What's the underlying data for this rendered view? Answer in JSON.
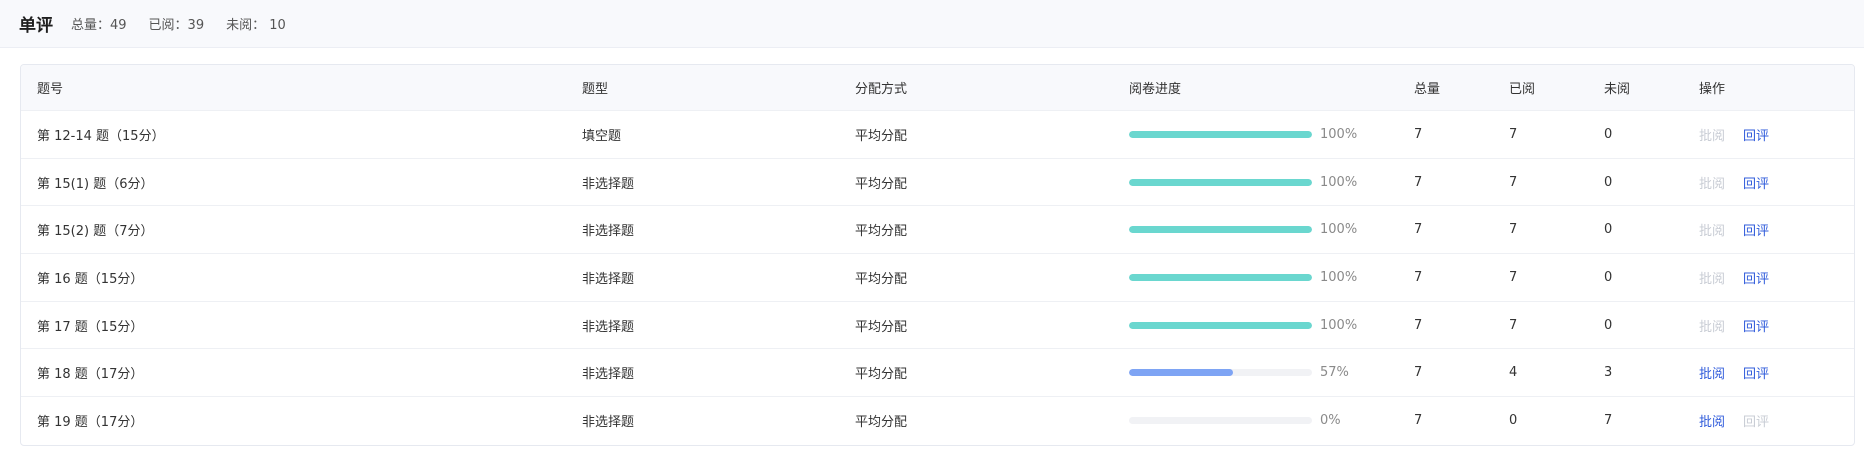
{
  "header": {
    "title": "单评",
    "total": "总量：49",
    "read": "已阅：39",
    "unread": "未阅： 10"
  },
  "table": {
    "columns": [
      "题号",
      "题型",
      "分配方式",
      "阅卷进度",
      "总量",
      "已阅",
      "未阅",
      "操作"
    ],
    "rows": [
      {
        "question": "第  12-14  题（15分）",
        "type": "填空题",
        "dist": "平均分配",
        "progress": 100,
        "progress_label": "100%",
        "total": "7",
        "read": "7",
        "unread": "0",
        "grade": "批阅",
        "grade_enabled": false,
        "review": "回评",
        "review_enabled": true
      },
      {
        "question": "第  15(1)  题（6分）",
        "type": "非选择题",
        "dist": "平均分配",
        "progress": 100,
        "progress_label": "100%",
        "total": "7",
        "read": "7",
        "unread": "0",
        "grade": "批阅",
        "grade_enabled": false,
        "review": "回评",
        "review_enabled": true
      },
      {
        "question": "第  15(2)  题（7分）",
        "type": "非选择题",
        "dist": "平均分配",
        "progress": 100,
        "progress_label": "100%",
        "total": "7",
        "read": "7",
        "unread": "0",
        "grade": "批阅",
        "grade_enabled": false,
        "review": "回评",
        "review_enabled": true
      },
      {
        "question": "第  16  题（15分）",
        "type": "非选择题",
        "dist": "平均分配",
        "progress": 100,
        "progress_label": "100%",
        "total": "7",
        "read": "7",
        "unread": "0",
        "grade": "批阅",
        "grade_enabled": false,
        "review": "回评",
        "review_enabled": true
      },
      {
        "question": "第  17  题（15分）",
        "type": "非选择题",
        "dist": "平均分配",
        "progress": 100,
        "progress_label": "100%",
        "total": "7",
        "read": "7",
        "unread": "0",
        "grade": "批阅",
        "grade_enabled": false,
        "review": "回评",
        "review_enabled": true
      },
      {
        "question": "第  18  题（17分）",
        "type": "非选择题",
        "dist": "平均分配",
        "progress": 57,
        "progress_label": "57%",
        "total": "7",
        "read": "4",
        "unread": "3",
        "grade": "批阅",
        "grade_enabled": true,
        "review": "回评",
        "review_enabled": true
      },
      {
        "question": "第  19  题（17分）",
        "type": "非选择题",
        "dist": "平均分配",
        "progress": 0,
        "progress_label": "0%",
        "total": "7",
        "read": "0",
        "unread": "7",
        "grade": "批阅",
        "grade_enabled": true,
        "review": "回评",
        "review_enabled": false
      }
    ]
  },
  "colors": {
    "complete": "#6ad7cf",
    "partial": "#7ea4f4",
    "track": "#f1f2f5",
    "link": "#2f5bdb",
    "link_disabled": "#c8ccd4"
  }
}
